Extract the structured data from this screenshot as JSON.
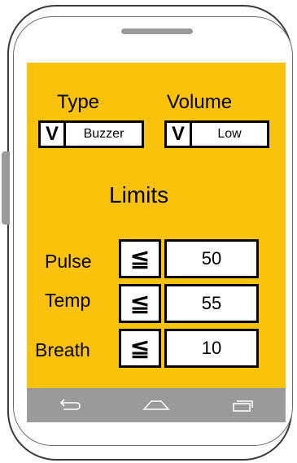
{
  "alarm": {
    "type_label": "Type",
    "type_value": "Buzzer",
    "volume_label": "Volume",
    "volume_value": "Low",
    "dropdown_toggle": "V"
  },
  "limits": {
    "title": "Limits",
    "rows": [
      {
        "label": "Pulse",
        "comparator": "≦",
        "value": "50"
      },
      {
        "label": "Temp",
        "comparator": "≦",
        "value": "55"
      },
      {
        "label": "Breath",
        "comparator": "≦",
        "value": "10"
      }
    ]
  },
  "nav": {
    "icons": [
      "back-icon",
      "home-icon",
      "recents-icon"
    ]
  },
  "colors": {
    "screen_background": "#fbc20b",
    "navbar": "#9a9a9a",
    "nav_icon": "#ffffff"
  }
}
